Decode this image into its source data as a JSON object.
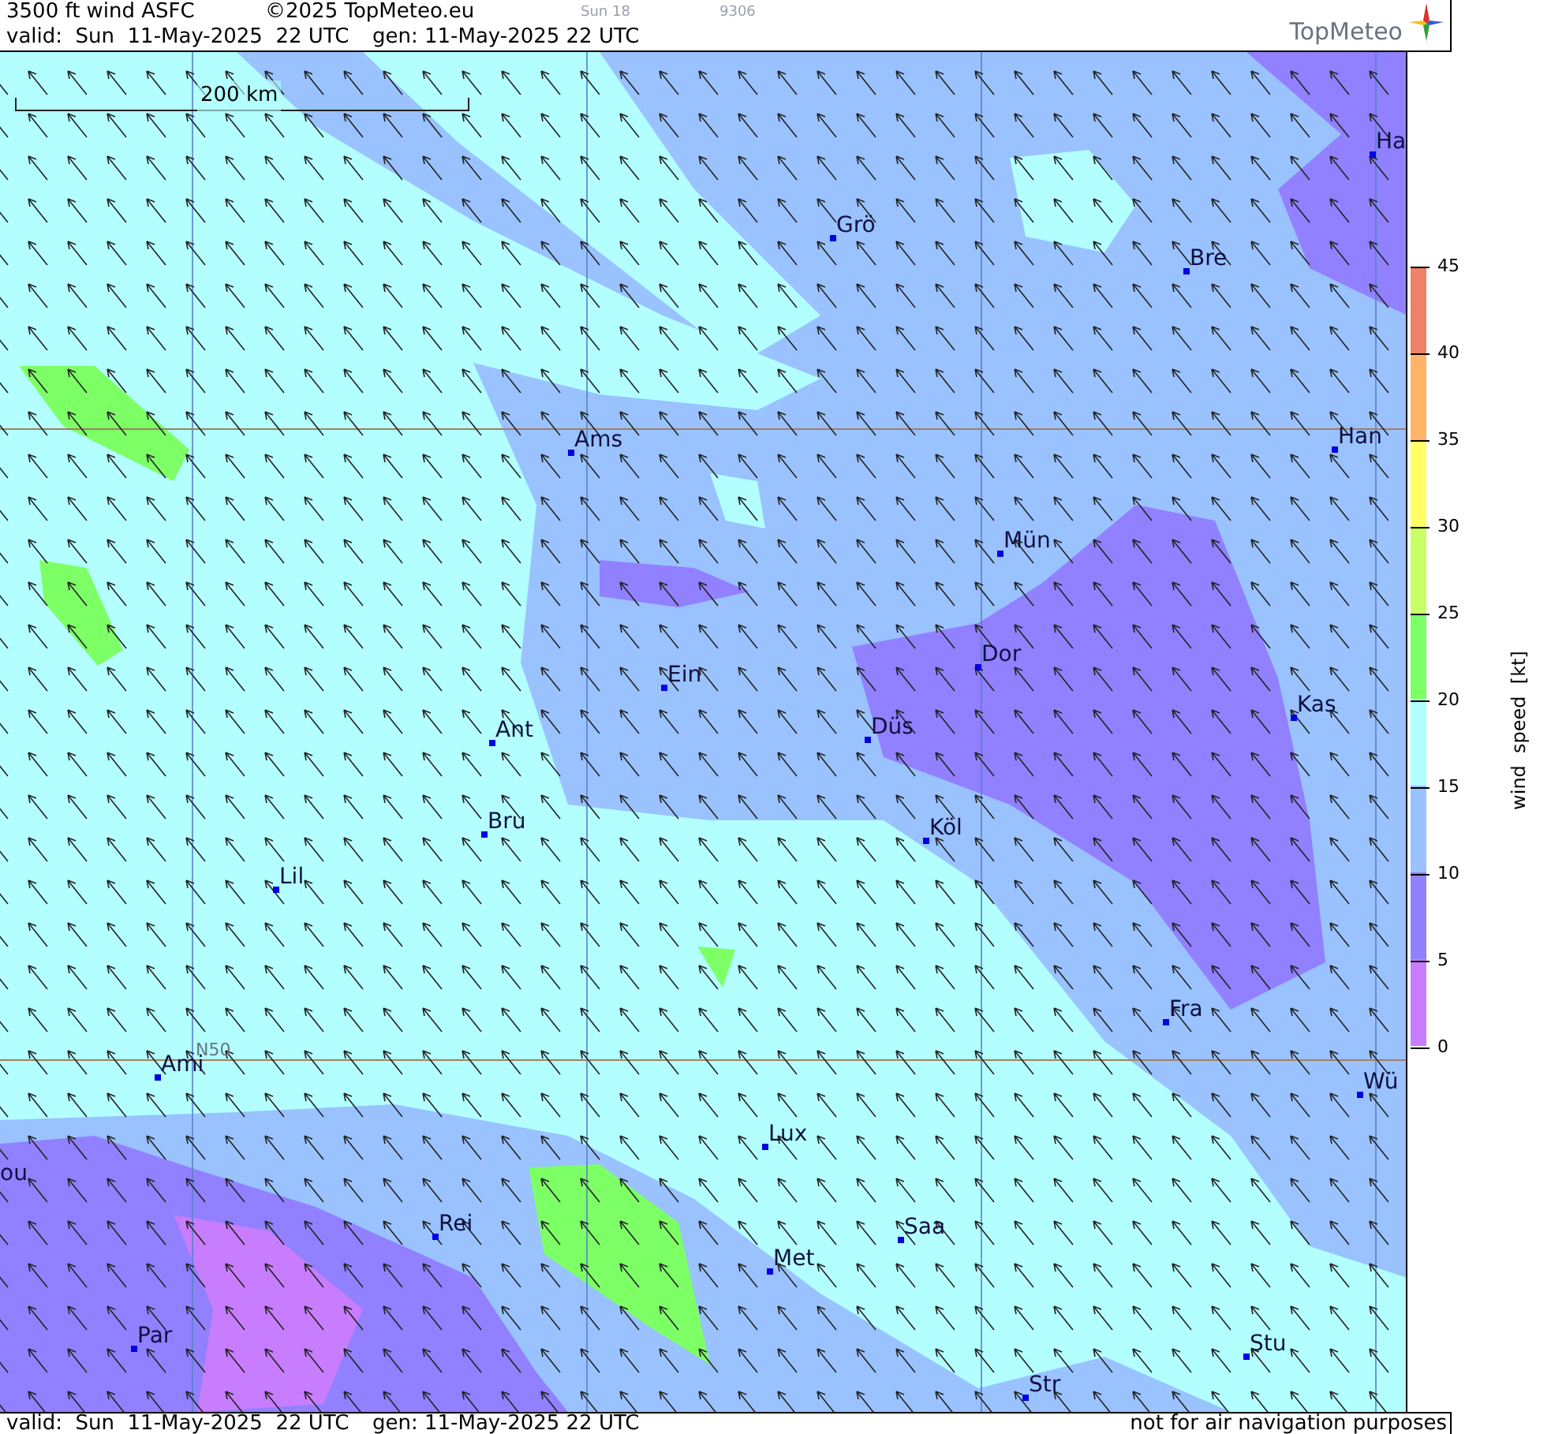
{
  "header": {
    "title": "3500 ft wind ASFC",
    "copyright": "©2025 TopMeteo.eu",
    "day": "Sun 18",
    "code": "9306",
    "valid": "valid:  Sun  11-May-2025  22 UTC",
    "generated": "gen: 11-May-2025 22 UTC",
    "logo": "TopMeteo"
  },
  "map": {
    "scale_label": "200 km",
    "grid_label": "N50",
    "cities": [
      {
        "name": "Ha"
      },
      {
        "name": "Grö"
      },
      {
        "name": "Bre"
      },
      {
        "name": "Han"
      },
      {
        "name": "Ams"
      },
      {
        "name": "Mün"
      },
      {
        "name": "Dor"
      },
      {
        "name": "Ein"
      },
      {
        "name": "Kas"
      },
      {
        "name": "Düs"
      },
      {
        "name": "Ant"
      },
      {
        "name": "Köl"
      },
      {
        "name": "Bru"
      },
      {
        "name": "Lil"
      },
      {
        "name": "Fra"
      },
      {
        "name": "Ami"
      },
      {
        "name": "Wü"
      },
      {
        "name": "Lux"
      },
      {
        "name": "ou"
      },
      {
        "name": "Saa"
      },
      {
        "name": "Rei"
      },
      {
        "name": "Met"
      },
      {
        "name": "Par"
      },
      {
        "name": "Stu"
      },
      {
        "name": "Str"
      }
    ]
  },
  "legend": {
    "title": "wind  speed  [kt]",
    "ticks": [
      "45",
      "40",
      "35",
      "30",
      "25",
      "20",
      "15",
      "10",
      "5",
      "0"
    ],
    "bins": [
      {
        "color": "#f08066"
      },
      {
        "color": "#ffb366"
      },
      {
        "color": "#ffff66"
      },
      {
        "color": "#c8ff66"
      },
      {
        "color": "#7dff66"
      },
      {
        "color": "#b3ffff"
      },
      {
        "color": "#99c2ff"
      },
      {
        "color": "#9180ff"
      },
      {
        "color": "#c87dff"
      }
    ]
  },
  "footer": {
    "valid": "valid:  Sun  11-May-2025  22 UTC",
    "generated": "gen: 11-May-2025 22 UTC",
    "disclaimer": "not for air navigation purposes"
  }
}
